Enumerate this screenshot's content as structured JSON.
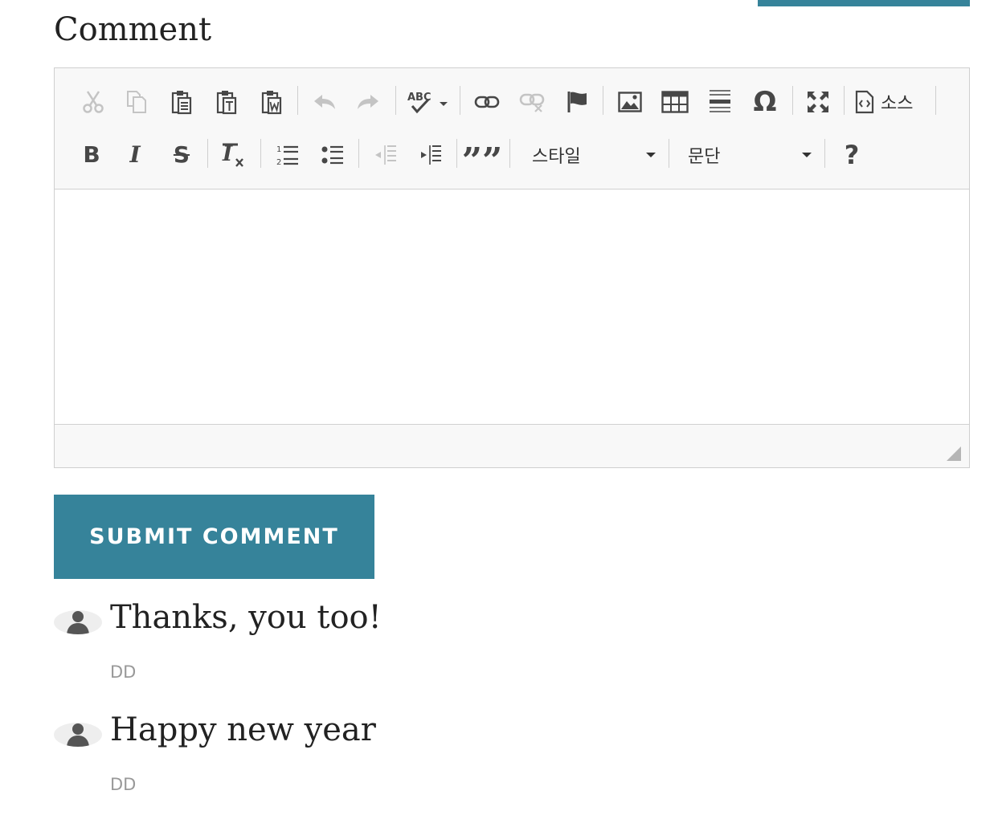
{
  "section": {
    "heading": "Comment"
  },
  "toolbar": {
    "icons": [
      "cut-icon",
      "copy-icon",
      "paste-icon",
      "paste-text-icon",
      "paste-word-icon",
      "undo-icon",
      "redo-icon",
      "spellcheck-icon",
      "link-icon",
      "unlink-icon",
      "anchor-icon",
      "image-icon",
      "table-icon",
      "horizontal-rule-icon",
      "special-char-icon",
      "maximize-icon",
      "source-icon",
      "bold-icon",
      "italic-icon",
      "strikethrough-icon",
      "remove-format-icon",
      "numbered-list-icon",
      "bulleted-list-icon",
      "outdent-icon",
      "indent-icon",
      "blockquote-icon",
      "help-icon"
    ],
    "source_label": "소스",
    "styles_label": "스타일",
    "format_label": "문단",
    "help_glyph": "?",
    "omega_glyph": "Ω",
    "bold_glyph": "B",
    "italic_glyph": "I",
    "strike_glyph": "S",
    "quote_glyph": "””"
  },
  "editor": {
    "content": ""
  },
  "submit": {
    "label": "SUBMIT COMMENT"
  },
  "comments": [
    {
      "text": "Thanks, you too!",
      "author": "DD"
    },
    {
      "text": "Happy new year",
      "author": "DD"
    }
  ],
  "colors": {
    "accent": "#36839a",
    "toolbar_bg": "#f8f8f8",
    "author_gray": "#999999"
  }
}
